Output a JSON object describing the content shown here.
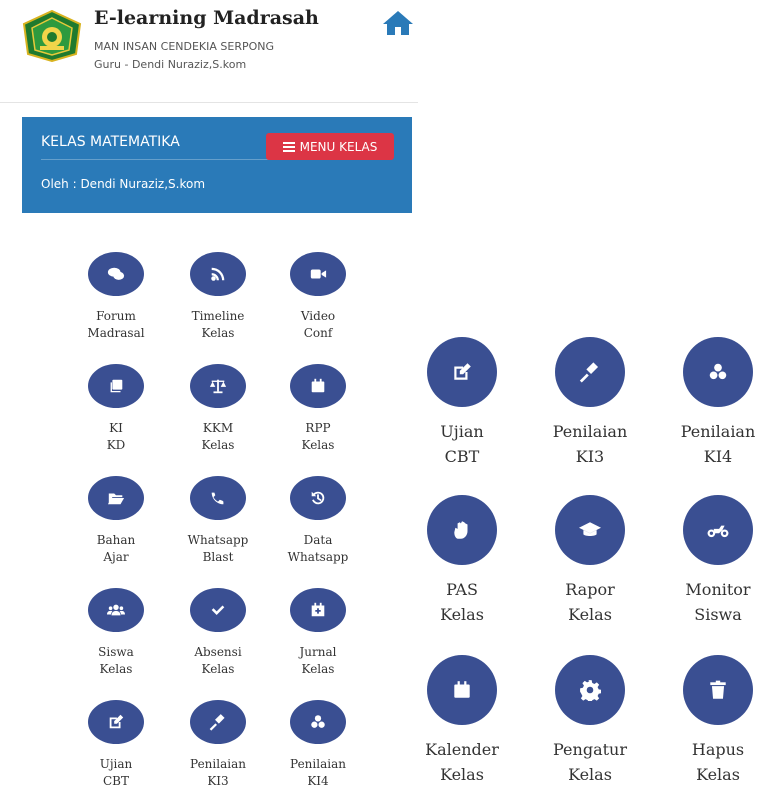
{
  "header": {
    "title": "E-learning Madrasah",
    "school": "MAN INSAN CENDEKIA SERPONG",
    "teacher": "Guru - Dendi Nuraziz,S.kom"
  },
  "banner": {
    "class_name": "KELAS MATEMATIKA",
    "owner": "Oleh : Dendi Nuraziz,S.kom",
    "menu_label": "MENU KELAS"
  },
  "small_menu": [
    {
      "line1": "Forum",
      "line2": "Madrasal",
      "icon": "comments-icon"
    },
    {
      "line1": "Timeline",
      "line2": "Kelas",
      "icon": "rss-icon"
    },
    {
      "line1": "Video",
      "line2": "Conf",
      "icon": "video-icon"
    },
    {
      "line1": "KI",
      "line2": "KD",
      "icon": "clone-icon"
    },
    {
      "line1": "KKM",
      "line2": "Kelas",
      "icon": "balance-scale-icon"
    },
    {
      "line1": "RPP",
      "line2": "Kelas",
      "icon": "calendar-icon"
    },
    {
      "line1": "Bahan",
      "line2": "Ajar",
      "icon": "folder-open-icon"
    },
    {
      "line1": "Whatsapp",
      "line2": "Blast",
      "icon": "phone-icon"
    },
    {
      "line1": "Data",
      "line2": "Whatsapp",
      "icon": "history-icon"
    },
    {
      "line1": "Siswa",
      "line2": "Kelas",
      "icon": "users-icon"
    },
    {
      "line1": "Absensi",
      "line2": "Kelas",
      "icon": "check-icon"
    },
    {
      "line1": "Jurnal",
      "line2": "Kelas",
      "icon": "calendar-plus-icon"
    },
    {
      "line1": "Ujian",
      "line2": "CBT",
      "icon": "edit-icon"
    },
    {
      "line1": "Penilaian",
      "line2": "KI3",
      "icon": "gavel-icon"
    },
    {
      "line1": "Penilaian",
      "line2": "KI4",
      "icon": "cubes-icon"
    }
  ],
  "large_menu": [
    {
      "line1": "Ujian",
      "line2": "CBT",
      "icon": "edit-icon"
    },
    {
      "line1": "Penilaian",
      "line2": "KI3",
      "icon": "gavel-icon"
    },
    {
      "line1": "Penilaian",
      "line2": "KI4",
      "icon": "cubes-icon"
    },
    {
      "line1": "PAS",
      "line2": "Kelas",
      "icon": "hand-icon"
    },
    {
      "line1": "Rapor",
      "line2": "Kelas",
      "icon": "graduation-cap-icon"
    },
    {
      "line1": "Monitor",
      "line2": "Siswa",
      "icon": "motorcycle-icon"
    },
    {
      "line1": "Kalender",
      "line2": "Kelas",
      "icon": "calendar-icon"
    },
    {
      "line1": "Pengatur",
      "line2": "Kelas",
      "icon": "cog-icon"
    },
    {
      "line1": "Hapus",
      "line2": "Kelas",
      "icon": "trash-icon"
    }
  ],
  "colors": {
    "banner": "#2a7ab8",
    "menu_button": "#dc3545",
    "icon_circle": "#3a4f92",
    "home_icon": "#2a7ab8"
  }
}
